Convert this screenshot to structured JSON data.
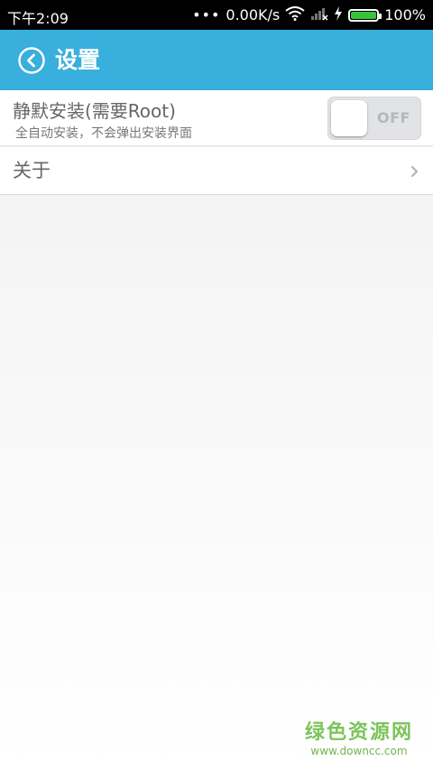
{
  "status_bar": {
    "time": "下午2:09",
    "dots": "•••",
    "net_speed": "0.00K/s",
    "battery": "100%",
    "battery_level": 1.0,
    "icons": [
      "wifi-icon",
      "signal-icon",
      "charging-icon",
      "battery-icon"
    ]
  },
  "header": {
    "title": "设置",
    "back_icon": "back-circle-icon",
    "color": "#38afdd"
  },
  "settings": {
    "silent_install": {
      "title": "静默安装(需要Root)",
      "subtitle": "全自动安装，不会弹出安装界面",
      "toggle_label": "OFF",
      "enabled": false
    },
    "about": {
      "title": "关于",
      "icon": "chevron-right-icon"
    }
  },
  "watermark": {
    "text": "绿色资源网",
    "url": "www.downcc.com"
  }
}
